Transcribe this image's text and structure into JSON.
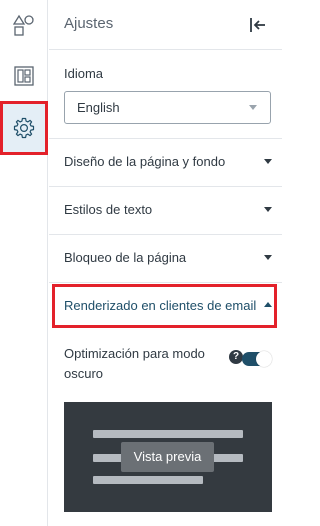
{
  "sidebar": {
    "items": [
      {
        "icon": "shapes-icon",
        "label": ""
      },
      {
        "icon": "layout-icon",
        "label": ""
      },
      {
        "icon": "gear-icon",
        "label": "",
        "selected": true
      }
    ]
  },
  "panel": {
    "title": "Ajustes",
    "collapse_icon": "collapse-left-icon"
  },
  "language": {
    "label": "Idioma",
    "value": "English"
  },
  "sections": [
    {
      "label": "Diseño de la página y fondo",
      "expanded": false
    },
    {
      "label": "Estilos de texto",
      "expanded": false
    },
    {
      "label": "Bloqueo de la página",
      "expanded": false
    },
    {
      "label": "Renderizado en clientes de email",
      "expanded": true
    }
  ],
  "dark_mode": {
    "label": "Optimización para modo oscuro",
    "help": "?",
    "enabled": true
  },
  "preview": {
    "button_label": "Vista previa"
  },
  "colors": {
    "accent": "#1f4f69",
    "highlight": "#e3212a",
    "selected_bg": "#e4eef6",
    "preview_bg": "#343a40"
  }
}
